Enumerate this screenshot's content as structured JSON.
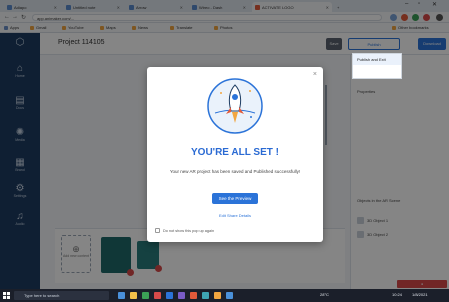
{
  "browser": {
    "tabs": [
      {
        "label": "Adiapo"
      },
      {
        "label": "Untitled note"
      },
      {
        "label": "Arrow"
      },
      {
        "label": "Wireo - Dash"
      },
      {
        "label": "ACTIVATE LOGO"
      },
      {
        "label": "+"
      }
    ],
    "address": "app.animaker.com/...",
    "bookmarks": [
      {
        "label": "Apps"
      },
      {
        "label": "Gmail"
      },
      {
        "label": "YouTube"
      },
      {
        "label": "Maps"
      },
      {
        "label": "News"
      },
      {
        "label": "Translate"
      },
      {
        "label": "Photos"
      },
      {
        "label": "Other bookmarks"
      }
    ]
  },
  "app": {
    "project_name": "Project 114105",
    "rail_items": [
      {
        "label": "Home"
      },
      {
        "label": "Docs"
      },
      {
        "label": "Media"
      },
      {
        "label": "Brand"
      },
      {
        "label": "Settings"
      },
      {
        "label": "Audio"
      }
    ],
    "buttons": {
      "save": "Save",
      "publish": "Publish",
      "download": "Download"
    },
    "dropdown_item": "Publish and Exit",
    "right_panel": {
      "header": "Properties",
      "section_title": "Objects in the AR Scene",
      "objects": [
        {
          "label": "3D Object 1"
        },
        {
          "label": "3D Object 2"
        }
      ]
    },
    "add_content": "Add new content"
  },
  "modal": {
    "title": "YOU'RE ALL SET !",
    "message": "Your new AR project has been saved and Published successfully!",
    "primary_button": "See the Preview",
    "link": "Edit Share Details",
    "checkbox_label": "Do not show this pop up again"
  },
  "taskbar": {
    "search_placeholder": "Type here to search",
    "time": "10:24",
    "date": "1/8/2021",
    "weather": "28°C"
  },
  "colors": {
    "accent": "#2b73d8",
    "rail": "#1e3d63",
    "title": "#2a6ad3",
    "rocket": "#e25a3a"
  }
}
